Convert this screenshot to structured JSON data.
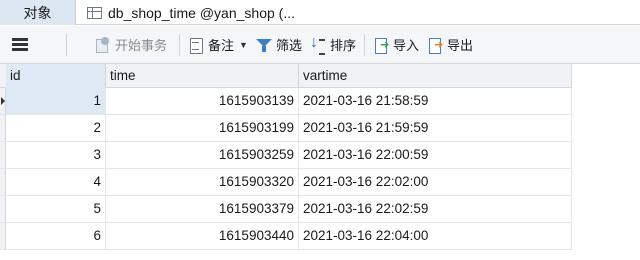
{
  "tabs": {
    "objects_label": "对象",
    "table_label": "db_shop_time @yan_shop (..."
  },
  "toolbar": {
    "begin_transaction": "开始事务",
    "memo": "备注",
    "filter": "筛选",
    "sort": "排序",
    "import": "导入",
    "export": "导出",
    "icons": [
      "menu-icon",
      "transaction-icon",
      "memo-icon",
      "filter-icon",
      "sort-icon",
      "import-icon",
      "export-icon"
    ]
  },
  "grid": {
    "columns": [
      "id",
      "time",
      "vartime"
    ],
    "rows": [
      {
        "id": "1",
        "time": "1615903139",
        "vartime": "2021-03-16 21:58:59"
      },
      {
        "id": "2",
        "time": "1615903199",
        "vartime": "2021-03-16 21:59:59"
      },
      {
        "id": "3",
        "time": "1615903259",
        "vartime": "2021-03-16 22:00:59"
      },
      {
        "id": "4",
        "time": "1615903320",
        "vartime": "2021-03-16 22:02:00"
      },
      {
        "id": "5",
        "time": "1615903379",
        "vartime": "2021-03-16 22:02:59"
      },
      {
        "id": "6",
        "time": "1615903440",
        "vartime": "2021-03-16 22:04:00"
      }
    ],
    "selected_row": 0
  },
  "colors": {
    "selected_tab": "#dde7f3",
    "toolbar_bg": "#f5f6f7",
    "header_bg": "#f0f2f4",
    "accent": "#3b7fc4"
  }
}
